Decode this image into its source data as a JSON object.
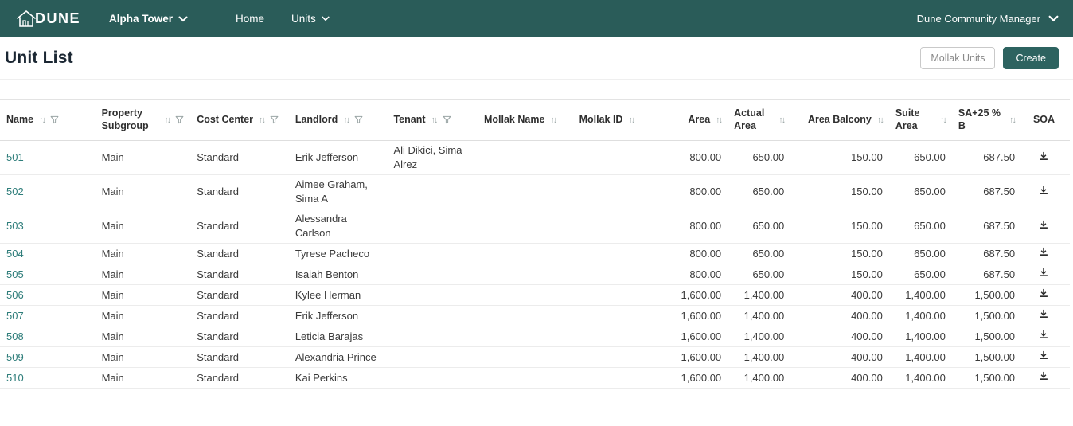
{
  "navbar": {
    "brand": "DUNE",
    "property_selector": {
      "label": "Alpha Tower"
    },
    "items": [
      {
        "label": "Home"
      },
      {
        "label": "Units"
      }
    ],
    "user_menu": {
      "label": "Dune Community Manager"
    }
  },
  "page_header": {
    "title": "Unit List",
    "mollak_units_label": "Mollak Units",
    "create_label": "Create"
  },
  "colors": {
    "navbar_bg": "#2a5c59",
    "accent": "#2d6360",
    "link": "#2e7d7a"
  },
  "table": {
    "columns": [
      {
        "key": "name",
        "label": "Name",
        "align": "left",
        "sort": true,
        "filter": true
      },
      {
        "key": "property_subgroup",
        "label": "Property Subgroup",
        "align": "left",
        "sort": true,
        "filter": true
      },
      {
        "key": "cost_center",
        "label": "Cost Center",
        "align": "left",
        "sort": true,
        "filter": true
      },
      {
        "key": "landlord",
        "label": "Landlord",
        "align": "left",
        "sort": true,
        "filter": true
      },
      {
        "key": "tenant",
        "label": "Tenant",
        "align": "left",
        "sort": true,
        "filter": true
      },
      {
        "key": "mollak_name",
        "label": "Mollak Name",
        "align": "left",
        "sort": true,
        "filter": false
      },
      {
        "key": "mollak_id",
        "label": "Mollak ID",
        "align": "left",
        "sort": true,
        "filter": false
      },
      {
        "key": "area",
        "label": "Area",
        "align": "right",
        "sort": true,
        "filter": false
      },
      {
        "key": "actual_area",
        "label": "Actual Area",
        "align": "right",
        "sort": true,
        "filter": false
      },
      {
        "key": "area_balcony",
        "label": "Area Balcony",
        "align": "right",
        "sort": true,
        "filter": false
      },
      {
        "key": "suite_area",
        "label": "Suite Area",
        "align": "right",
        "sort": true,
        "filter": false
      },
      {
        "key": "sa25b",
        "label": "SA+25 % B",
        "align": "right",
        "sort": true,
        "filter": false
      },
      {
        "key": "soa",
        "label": "SOA",
        "align": "center",
        "sort": false,
        "filter": false
      }
    ],
    "rows": [
      {
        "name": "501",
        "property_subgroup": "Main",
        "cost_center": "Standard",
        "landlord": "Erik Jefferson",
        "tenant": "Ali Dikici, Sima Alrez",
        "mollak_name": "",
        "mollak_id": "",
        "area": "800.00",
        "actual_area": "650.00",
        "area_balcony": "150.00",
        "suite_area": "650.00",
        "sa25b": "687.50"
      },
      {
        "name": "502",
        "property_subgroup": "Main",
        "cost_center": "Standard",
        "landlord": "Aimee Graham, Sima A",
        "tenant": "",
        "mollak_name": "",
        "mollak_id": "",
        "area": "800.00",
        "actual_area": "650.00",
        "area_balcony": "150.00",
        "suite_area": "650.00",
        "sa25b": "687.50"
      },
      {
        "name": "503",
        "property_subgroup": "Main",
        "cost_center": "Standard",
        "landlord": "Alessandra Carlson",
        "tenant": "",
        "mollak_name": "",
        "mollak_id": "",
        "area": "800.00",
        "actual_area": "650.00",
        "area_balcony": "150.00",
        "suite_area": "650.00",
        "sa25b": "687.50"
      },
      {
        "name": "504",
        "property_subgroup": "Main",
        "cost_center": "Standard",
        "landlord": "Tyrese Pacheco",
        "tenant": "",
        "mollak_name": "",
        "mollak_id": "",
        "area": "800.00",
        "actual_area": "650.00",
        "area_balcony": "150.00",
        "suite_area": "650.00",
        "sa25b": "687.50"
      },
      {
        "name": "505",
        "property_subgroup": "Main",
        "cost_center": "Standard",
        "landlord": "Isaiah Benton",
        "tenant": "",
        "mollak_name": "",
        "mollak_id": "",
        "area": "800.00",
        "actual_area": "650.00",
        "area_balcony": "150.00",
        "suite_area": "650.00",
        "sa25b": "687.50"
      },
      {
        "name": "506",
        "property_subgroup": "Main",
        "cost_center": "Standard",
        "landlord": "Kylee Herman",
        "tenant": "",
        "mollak_name": "",
        "mollak_id": "",
        "area": "1,600.00",
        "actual_area": "1,400.00",
        "area_balcony": "400.00",
        "suite_area": "1,400.00",
        "sa25b": "1,500.00"
      },
      {
        "name": "507",
        "property_subgroup": "Main",
        "cost_center": "Standard",
        "landlord": "Erik Jefferson",
        "tenant": "",
        "mollak_name": "",
        "mollak_id": "",
        "area": "1,600.00",
        "actual_area": "1,400.00",
        "area_balcony": "400.00",
        "suite_area": "1,400.00",
        "sa25b": "1,500.00"
      },
      {
        "name": "508",
        "property_subgroup": "Main",
        "cost_center": "Standard",
        "landlord": "Leticia Barajas",
        "tenant": "",
        "mollak_name": "",
        "mollak_id": "",
        "area": "1,600.00",
        "actual_area": "1,400.00",
        "area_balcony": "400.00",
        "suite_area": "1,400.00",
        "sa25b": "1,500.00"
      },
      {
        "name": "509",
        "property_subgroup": "Main",
        "cost_center": "Standard",
        "landlord": "Alexandria Prince",
        "tenant": "",
        "mollak_name": "",
        "mollak_id": "",
        "area": "1,600.00",
        "actual_area": "1,400.00",
        "area_balcony": "400.00",
        "suite_area": "1,400.00",
        "sa25b": "1,500.00"
      },
      {
        "name": "510",
        "property_subgroup": "Main",
        "cost_center": "Standard",
        "landlord": "Kai Perkins",
        "tenant": "",
        "mollak_name": "",
        "mollak_id": "",
        "area": "1,600.00",
        "actual_area": "1,400.00",
        "area_balcony": "400.00",
        "suite_area": "1,400.00",
        "sa25b": "1,500.00"
      }
    ]
  }
}
